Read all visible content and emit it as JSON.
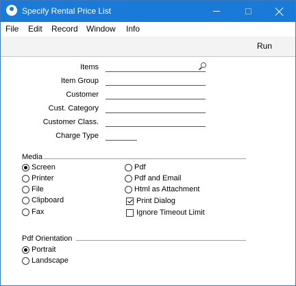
{
  "window": {
    "title": "Specify Rental Price List"
  },
  "menu": [
    "File",
    "Edit",
    "Record",
    "Window",
    "Info"
  ],
  "toolbar": {
    "run_label": "Run"
  },
  "fields": {
    "items_label": "Items",
    "item_group_label": "Item Group",
    "customer_label": "Customer",
    "cust_category_label": "Cust. Category",
    "customer_class_label": "Customer Class.",
    "charge_type_label": "Charge Type"
  },
  "media": {
    "title": "Media",
    "options": {
      "screen": "Screen",
      "printer": "Printer",
      "file": "File",
      "clipboard": "Clipboard",
      "fax": "Fax",
      "pdf": "Pdf",
      "pdf_email": "Pdf and Email",
      "html_attachment": "Html as Attachment"
    },
    "selected": "Screen",
    "print_dialog": {
      "label": "Print Dialog",
      "checked": true
    },
    "ignore_timeout": {
      "label": "Ignore Timeout Limit",
      "checked": false
    }
  },
  "pdf_orientation": {
    "title": "Pdf Orientation",
    "options": {
      "portrait": "Portrait",
      "landscape": "Landscape"
    },
    "selected": "Portrait"
  },
  "colors": {
    "titlebar": "#1a7ad8",
    "toolbar": "#f3f3f3"
  },
  "icons": {
    "app": "app-icon",
    "search": "search-icon",
    "minimize": "minimize-icon",
    "maximize": "maximize-icon",
    "close": "close-icon"
  }
}
